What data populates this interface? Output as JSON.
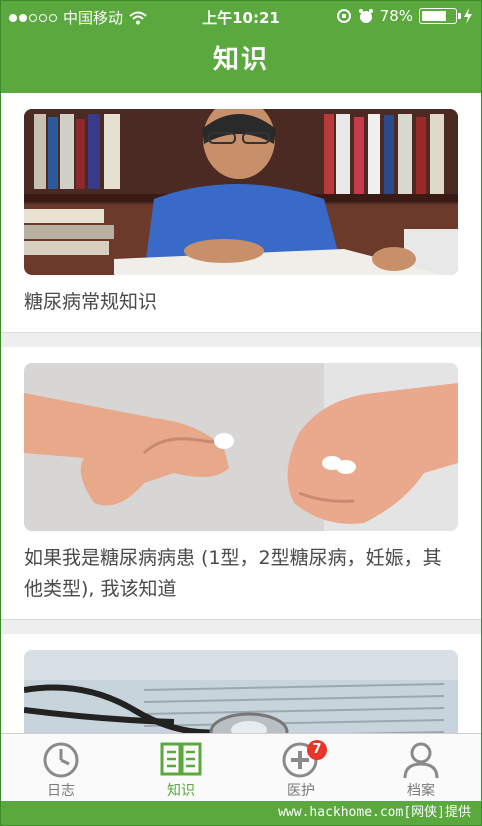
{
  "status_bar": {
    "carrier": "中国移动",
    "time": "上午10:21",
    "battery": "78%",
    "battery_level": 0.78
  },
  "nav": {
    "title": "知识"
  },
  "cards": [
    {
      "title": "糖尿病常规知识",
      "image": "reading-elder-photo"
    },
    {
      "title": "如果我是糖尿病病患 (1型，2型糖尿病，妊娠，其他类型), 我该知道",
      "image": "pills-in-hands-photo"
    },
    {
      "title": "",
      "image": "stethoscope-photo"
    }
  ],
  "tabs": [
    {
      "label": "日志",
      "icon": "clock-icon",
      "active": false
    },
    {
      "label": "知识",
      "icon": "book-icon",
      "active": true
    },
    {
      "label": "医护",
      "icon": "medical-plus-icon",
      "active": false,
      "badge": "7"
    },
    {
      "label": "档案",
      "icon": "person-icon",
      "active": false
    }
  ],
  "watermark": "www.hackhome.com[网侠]提供",
  "colors": {
    "brand_green": "#5aa83e",
    "badge_red": "#e8352a"
  }
}
